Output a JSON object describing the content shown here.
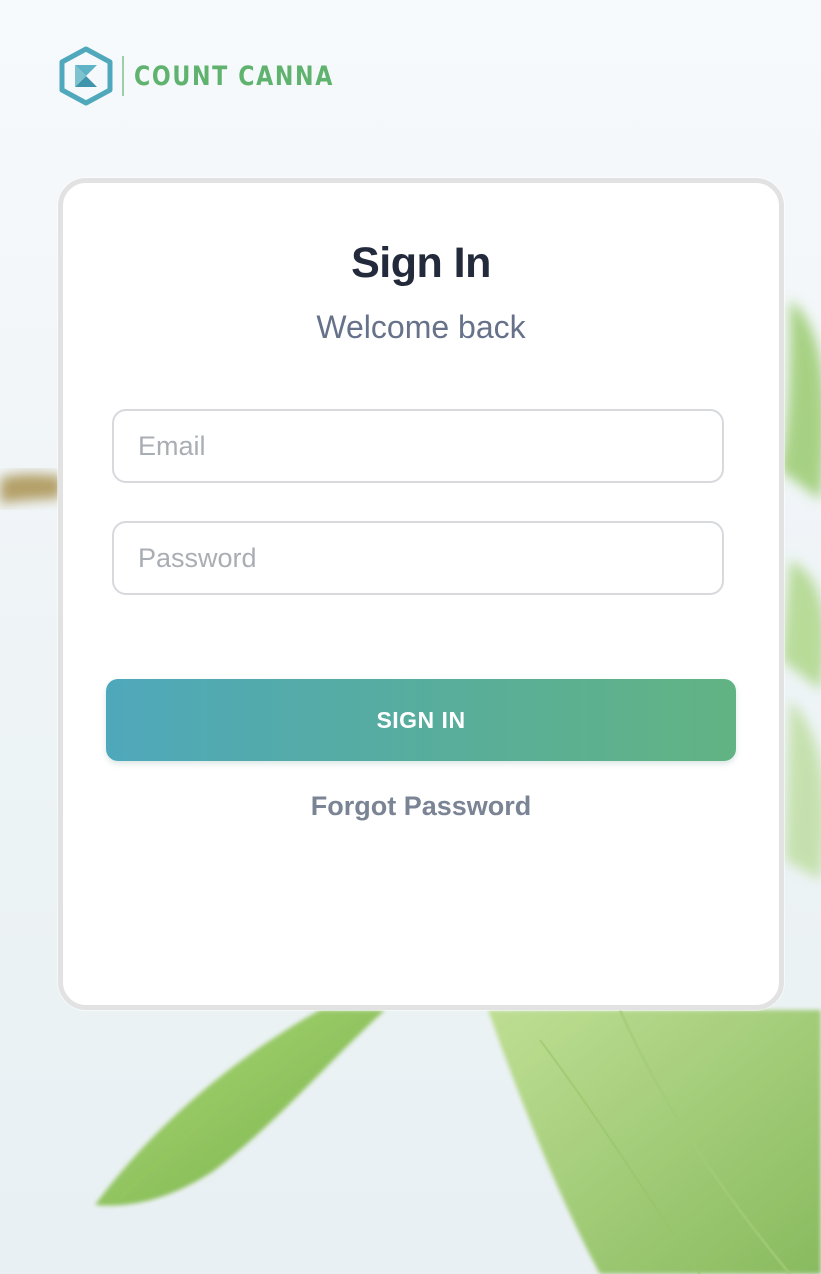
{
  "brand": {
    "name": "COUNT CANNA",
    "logo_icon": "count-canna-hexagon-logo",
    "color": "#5fb36f"
  },
  "signin_card": {
    "title": "Sign In",
    "subtitle": "Welcome back",
    "email": {
      "placeholder": "Email",
      "value": ""
    },
    "password": {
      "placeholder": "Password",
      "value": ""
    },
    "submit_label": "SIGN IN",
    "forgot_password_label": "Forgot Password"
  },
  "theme": {
    "accent_start": "#4fa8bb",
    "accent_end": "#62b383",
    "title_color": "#232a3b",
    "subtitle_color": "#66718a",
    "link_color": "#7b8495"
  }
}
